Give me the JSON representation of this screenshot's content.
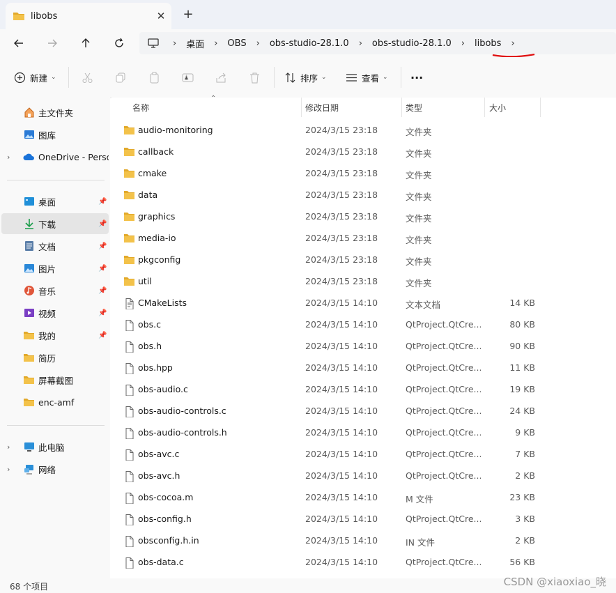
{
  "window": {
    "tab_title": "libobs",
    "close_glyph": "✕",
    "newtab_glyph": "+"
  },
  "nav": {
    "breadcrumbs": [
      "桌面",
      "OBS",
      "obs-studio-28.1.0",
      "obs-studio-28.1.0",
      "libobs"
    ],
    "sep": "›"
  },
  "toolbar": {
    "new_label": "新建",
    "sort_label": "排序",
    "view_label": "查看",
    "more_glyph": "···",
    "caret": "⌄"
  },
  "sidebar": {
    "quick": [
      {
        "label": "主文件夹",
        "icon": "home-icon"
      },
      {
        "label": "图库",
        "icon": "gallery-icon"
      },
      {
        "label": "OneDrive - Perso",
        "icon": "onedrive-icon",
        "expander": "›"
      }
    ],
    "pinned": [
      {
        "label": "桌面",
        "icon": "desktop-icon",
        "pin": "📌"
      },
      {
        "label": "下载",
        "icon": "download-icon",
        "pin": "📌",
        "selected": true
      },
      {
        "label": "文档",
        "icon": "document-icon",
        "pin": "📌"
      },
      {
        "label": "图片",
        "icon": "picture-icon",
        "pin": "📌"
      },
      {
        "label": "音乐",
        "icon": "music-icon",
        "pin": "📌"
      },
      {
        "label": "视频",
        "icon": "video-icon",
        "pin": "📌"
      },
      {
        "label": "我的",
        "icon": "folder-icon",
        "pin": "📌"
      },
      {
        "label": "简历",
        "icon": "folder-icon"
      },
      {
        "label": "屏幕截图",
        "icon": "folder-icon"
      },
      {
        "label": "enc-amf",
        "icon": "folder-icon"
      }
    ],
    "devices": [
      {
        "label": "此电脑",
        "icon": "computer-icon",
        "expander": "›"
      },
      {
        "label": "网络",
        "icon": "network-icon",
        "expander": "›"
      }
    ]
  },
  "columns": {
    "name": "名称",
    "date": "修改日期",
    "type": "类型",
    "size": "大小",
    "sort_caret": "⌃"
  },
  "files": [
    {
      "name": "audio-monitoring",
      "date": "2024/3/15 23:18",
      "type": "文件夹",
      "size": "",
      "kind": "folder"
    },
    {
      "name": "callback",
      "date": "2024/3/15 23:18",
      "type": "文件夹",
      "size": "",
      "kind": "folder"
    },
    {
      "name": "cmake",
      "date": "2024/3/15 23:18",
      "type": "文件夹",
      "size": "",
      "kind": "folder"
    },
    {
      "name": "data",
      "date": "2024/3/15 23:18",
      "type": "文件夹",
      "size": "",
      "kind": "folder"
    },
    {
      "name": "graphics",
      "date": "2024/3/15 23:18",
      "type": "文件夹",
      "size": "",
      "kind": "folder"
    },
    {
      "name": "media-io",
      "date": "2024/3/15 23:18",
      "type": "文件夹",
      "size": "",
      "kind": "folder"
    },
    {
      "name": "pkgconfig",
      "date": "2024/3/15 23:18",
      "type": "文件夹",
      "size": "",
      "kind": "folder"
    },
    {
      "name": "util",
      "date": "2024/3/15 23:18",
      "type": "文件夹",
      "size": "",
      "kind": "folder"
    },
    {
      "name": "CMakeLists",
      "date": "2024/3/15 14:10",
      "type": "文本文档",
      "size": "14 KB",
      "kind": "text"
    },
    {
      "name": "obs.c",
      "date": "2024/3/15 14:10",
      "type": "QtProject.QtCre...",
      "size": "80 KB",
      "kind": "file"
    },
    {
      "name": "obs.h",
      "date": "2024/3/15 14:10",
      "type": "QtProject.QtCre...",
      "size": "90 KB",
      "kind": "file"
    },
    {
      "name": "obs.hpp",
      "date": "2024/3/15 14:10",
      "type": "QtProject.QtCre...",
      "size": "11 KB",
      "kind": "file"
    },
    {
      "name": "obs-audio.c",
      "date": "2024/3/15 14:10",
      "type": "QtProject.QtCre...",
      "size": "19 KB",
      "kind": "file"
    },
    {
      "name": "obs-audio-controls.c",
      "date": "2024/3/15 14:10",
      "type": "QtProject.QtCre...",
      "size": "24 KB",
      "kind": "file"
    },
    {
      "name": "obs-audio-controls.h",
      "date": "2024/3/15 14:10",
      "type": "QtProject.QtCre...",
      "size": "9 KB",
      "kind": "file"
    },
    {
      "name": "obs-avc.c",
      "date": "2024/3/15 14:10",
      "type": "QtProject.QtCre...",
      "size": "7 KB",
      "kind": "file"
    },
    {
      "name": "obs-avc.h",
      "date": "2024/3/15 14:10",
      "type": "QtProject.QtCre...",
      "size": "2 KB",
      "kind": "file"
    },
    {
      "name": "obs-cocoa.m",
      "date": "2024/3/15 14:10",
      "type": "M 文件",
      "size": "23 KB",
      "kind": "file"
    },
    {
      "name": "obs-config.h",
      "date": "2024/3/15 14:10",
      "type": "QtProject.QtCre...",
      "size": "3 KB",
      "kind": "file"
    },
    {
      "name": "obsconfig.h.in",
      "date": "2024/3/15 14:10",
      "type": "IN 文件",
      "size": "2 KB",
      "kind": "file"
    },
    {
      "name": "obs-data.c",
      "date": "2024/3/15 14:10",
      "type": "QtProject.QtCre...",
      "size": "56 KB",
      "kind": "file"
    }
  ],
  "status": {
    "count_text": "68 个项目"
  },
  "watermark": "CSDN @xiaoxiao_晓",
  "colors": {
    "folder": "#f3c24a",
    "folder_dark": "#e2a92b",
    "annotation": "#e01010",
    "selected": "#e5e5e5"
  }
}
